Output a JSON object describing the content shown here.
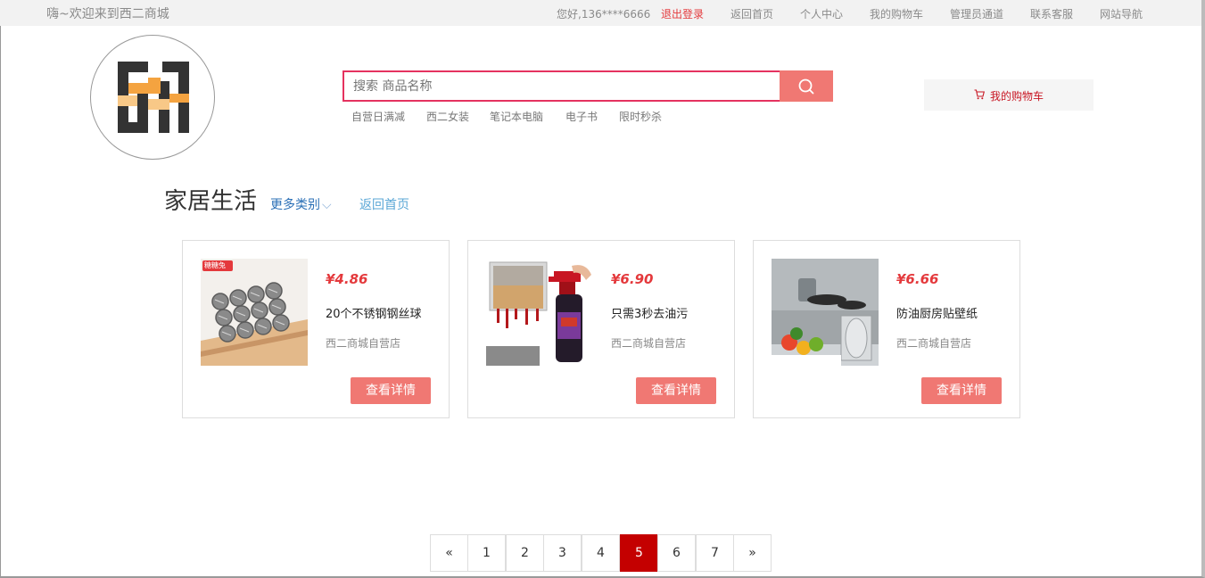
{
  "topbar": {
    "welcome": "嗨~欢迎来到西二商城",
    "greeting": "您好,136****6666",
    "logout": "退出登录",
    "links": [
      "返回首页",
      "个人中心",
      "我的购物车",
      "管理员通道",
      "联系客服",
      "网站导航"
    ]
  },
  "search": {
    "placeholder": "搜索 商品名称",
    "hotwords": [
      "自营日满减",
      "西二女装",
      "笔记本电脑",
      "电子书",
      "限时秒杀"
    ]
  },
  "cart": {
    "label": "我的购物车"
  },
  "category": {
    "title": "家居生活",
    "more": "更多类别",
    "back": "返回首页"
  },
  "products": [
    {
      "price": "¥4.86",
      "name": "20个不锈钢钢丝球",
      "shop": "西二商城自营店",
      "button": "查看详情",
      "badge": "糖糖兔"
    },
    {
      "price": "¥6.90",
      "name": "只需3秒去油污",
      "shop": "西二商城自营店",
      "button": "查看详情"
    },
    {
      "price": "¥6.66",
      "name": "防油厨房贴壁纸",
      "shop": "西二商城自营店",
      "button": "查看详情"
    }
  ],
  "pagination": {
    "prev": "«",
    "pages": [
      "1",
      "2",
      "3",
      "4",
      "5",
      "6",
      "7"
    ],
    "current": "5",
    "next": "»"
  },
  "colors": {
    "accent": "#f07873",
    "price": "#e4393c",
    "active_page": "#c40000",
    "search_border": "#e5325f"
  }
}
